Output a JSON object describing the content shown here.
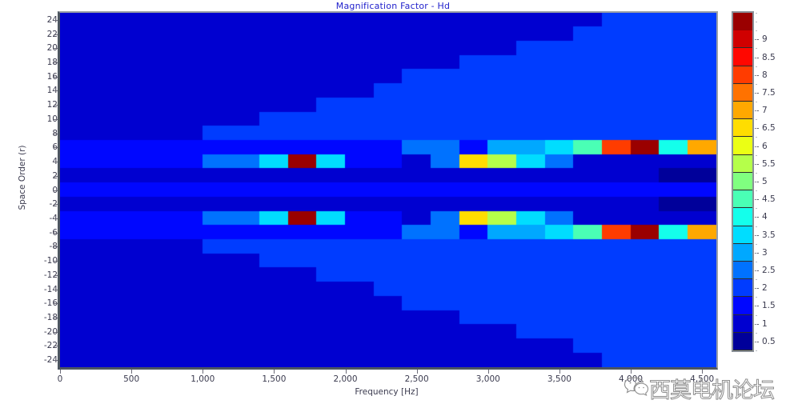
{
  "chart_data": {
    "type": "heatmap",
    "title": "Magnification Factor - Hd",
    "xlabel": "Frequency [Hz]",
    "ylabel": "Space Order (r)",
    "xlim": [
      0,
      4600
    ],
    "ylim": [
      -25,
      25
    ],
    "xticks": [
      0,
      500,
      1000,
      1500,
      2000,
      2500,
      3000,
      3500,
      4000,
      4500
    ],
    "xticklabels": [
      "0",
      "500",
      "1,000",
      "1,500",
      "2,000",
      "2,500",
      "3,000",
      "3,500",
      "4,000",
      "4,500"
    ],
    "yticks": [
      24,
      22,
      20,
      18,
      16,
      14,
      12,
      10,
      8,
      6,
      4,
      2,
      0,
      -2,
      -4,
      -6,
      -8,
      -10,
      -12,
      -14,
      -16,
      -18,
      -20,
      -22,
      -24
    ],
    "yticklabels": [
      "24",
      "22",
      "20",
      "18",
      "16",
      "14",
      "12",
      "10",
      "8",
      "6",
      "4",
      "2",
      "0",
      "-2",
      "-4",
      "-6",
      "-8",
      "-10",
      "-12",
      "-14",
      "-16",
      "-18",
      "-20",
      "-22",
      "-24"
    ],
    "grid": false,
    "colormap": "jet",
    "colorbar": {
      "min": 0.25,
      "max": 9.75,
      "step": 0.5,
      "ticks": [
        0.5,
        1,
        1.5,
        2,
        2.5,
        3,
        3.5,
        4,
        4.5,
        5,
        5.5,
        6,
        6.5,
        7,
        7.5,
        8,
        8.5,
        9
      ],
      "ticklabels": [
        "0.5",
        "1",
        "1.5",
        "2",
        "2.5",
        "3",
        "3.5",
        "4",
        "4.5",
        "5",
        "5.5",
        "6",
        "6.5",
        "7",
        "7.5",
        "8",
        "8.5",
        "9"
      ],
      "colors": [
        "#0000ff",
        "#0030ff",
        "#0060ff",
        "#0090ff",
        "#00c0ff",
        "#00f0ff",
        "#20ffd0",
        "#40ffa0",
        "#60ff60",
        "#90ff30",
        "#c0ff00",
        "#f0ff00",
        "#ffd000",
        "#ffa000",
        "#ff7000",
        "#ff4000",
        "#ff1500",
        "#ee0000"
      ]
    },
    "x_bin_width": 200,
    "y_bin_height": 2,
    "note": "Symmetric about r = 0; wedge-shaped low-value region expands with frequency; high-magnification ridges along r = +/-4 and r = +/-6 growing toward high frequency.",
    "cells": [
      {
        "r": 4,
        "bands": [
          [
            0,
            1000,
            1.5
          ],
          [
            1000,
            1400,
            2.6
          ],
          [
            1400,
            1600,
            3.6
          ],
          [
            1600,
            1800,
            9.6
          ],
          [
            1800,
            2000,
            3.6
          ],
          [
            2000,
            2400,
            1.3
          ],
          [
            2400,
            2600,
            0.9
          ],
          [
            2600,
            2800,
            2.6
          ],
          [
            2800,
            3000,
            6.3
          ],
          [
            3000,
            3200,
            5.4
          ],
          [
            3200,
            3400,
            3.4
          ],
          [
            3400,
            3600,
            2.7
          ],
          [
            3600,
            3800,
            1.2
          ],
          [
            3800,
            4000,
            1.2
          ],
          [
            4000,
            4200,
            0.9
          ],
          [
            4200,
            4400,
            1.0
          ],
          [
            4400,
            4600,
            0.8
          ]
        ]
      },
      {
        "r": 6,
        "bands": [
          [
            0,
            2400,
            1.5
          ],
          [
            2400,
            2600,
            2.4
          ],
          [
            2600,
            2800,
            2.4
          ],
          [
            2800,
            3000,
            1.3
          ],
          [
            3000,
            3200,
            2.9
          ],
          [
            3200,
            3400,
            3.1
          ],
          [
            3400,
            3600,
            3.5
          ],
          [
            3600,
            3800,
            4.3
          ],
          [
            3800,
            4000,
            7.8
          ],
          [
            4000,
            4200,
            9.6
          ],
          [
            4200,
            4400,
            4.2
          ],
          [
            4400,
            4600,
            6.9
          ]
        ]
      },
      {
        "r": 0,
        "bands": [
          [
            0,
            4600,
            1.6
          ]
        ]
      },
      {
        "r": 2,
        "bands": [
          [
            0,
            4600,
            0.9
          ]
        ]
      },
      {
        "r": -2,
        "bands": [
          [
            0,
            4600,
            0.9
          ]
        ]
      },
      {
        "r": -4,
        "bands": [
          [
            0,
            1000,
            1.5
          ],
          [
            1000,
            1400,
            2.6
          ],
          [
            1400,
            1600,
            3.6
          ],
          [
            1600,
            1800,
            9.6
          ],
          [
            1800,
            2000,
            3.6
          ],
          [
            2000,
            2400,
            1.3
          ],
          [
            2400,
            2600,
            0.9
          ],
          [
            2600,
            2800,
            2.6
          ],
          [
            2800,
            3000,
            6.3
          ],
          [
            3000,
            3200,
            5.4
          ],
          [
            3200,
            3400,
            3.4
          ],
          [
            3400,
            3600,
            2.7
          ],
          [
            3600,
            4000,
            1.2
          ],
          [
            4000,
            4200,
            0.9
          ],
          [
            4200,
            4400,
            1.0
          ],
          [
            4400,
            4600,
            0.8
          ]
        ]
      },
      {
        "r": -6,
        "bands": [
          [
            0,
            2400,
            1.5
          ],
          [
            2400,
            2600,
            2.4
          ],
          [
            2600,
            2800,
            2.4
          ],
          [
            2800,
            3000,
            1.3
          ],
          [
            3000,
            3200,
            2.9
          ],
          [
            3200,
            3400,
            3.1
          ],
          [
            3400,
            3600,
            3.5
          ],
          [
            3600,
            3800,
            4.3
          ],
          [
            3800,
            4000,
            7.8
          ],
          [
            4000,
            4200,
            9.6
          ],
          [
            4200,
            4400,
            4.2
          ],
          [
            4400,
            4600,
            6.9
          ]
        ]
      }
    ]
  },
  "watermark": {
    "text": "西莫电机论坛",
    "icon": "wechat-icon"
  }
}
